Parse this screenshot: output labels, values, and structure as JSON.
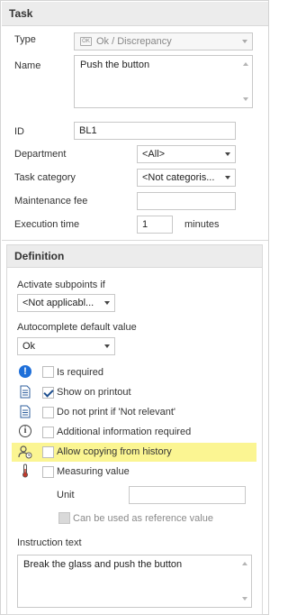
{
  "task": {
    "header": "Task",
    "type_label": "Type",
    "type_value": "Ok / Discrepancy",
    "type_icon": "ok-badge-icon",
    "name_label": "Name",
    "name_value": "Push the button",
    "id_label": "ID",
    "id_value": "BL1",
    "department_label": "Department",
    "department_value": "<All>",
    "category_label": "Task category",
    "category_value": "<Not categoris...",
    "fee_label": "Maintenance fee",
    "fee_value": "",
    "exec_label": "Execution time",
    "exec_value": "1",
    "exec_unit": "minutes"
  },
  "definition": {
    "header": "Definition",
    "subpoints_label": "Activate subpoints if",
    "subpoints_value": "<Not applicabl...",
    "autocomplete_label": "Autocomplete default value",
    "autocomplete_value": "Ok",
    "options": [
      {
        "label": "Is required",
        "checked": false,
        "icon": "exclamation-icon"
      },
      {
        "label": "Show on printout",
        "checked": true,
        "icon": "document-icon"
      },
      {
        "label": "Do not print if 'Not relevant'",
        "checked": false,
        "icon": "document-icon"
      },
      {
        "label": "Additional information required",
        "checked": false,
        "icon": "info-icon"
      },
      {
        "label": "Allow copying from history",
        "checked": false,
        "icon": "history-person-icon",
        "highlighted": true
      },
      {
        "label": "Measuring value",
        "checked": false,
        "icon": "thermometer-icon"
      }
    ],
    "unit_label": "Unit",
    "unit_value": "",
    "reference_label": "Can be used as reference value",
    "instruction_label": "Instruction text",
    "instruction_value": "Break the glass and push the button"
  },
  "colors": {
    "highlight": "#fbf592",
    "header_bg": "#ececec",
    "accent_blue": "#1e6fd9"
  }
}
